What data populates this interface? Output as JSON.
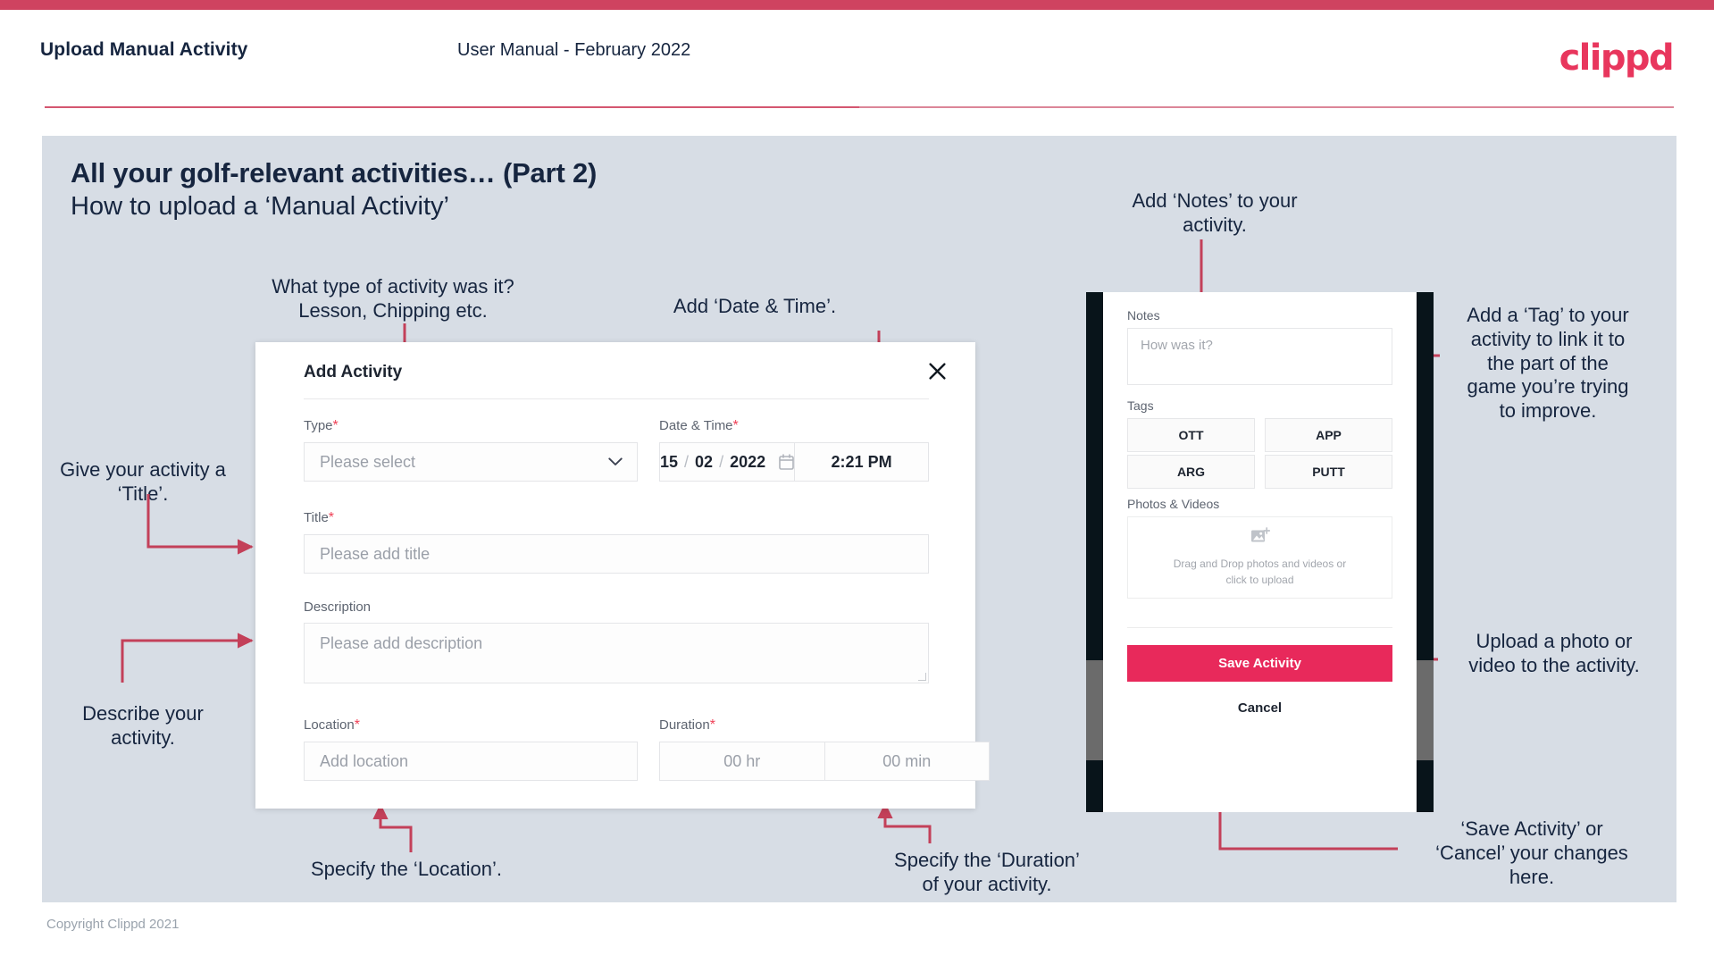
{
  "header": {
    "title": "Upload Manual Activity",
    "subtitle": "User Manual - February 2022",
    "brand": "clippd"
  },
  "slide": {
    "title": "All your golf-relevant activities… (Part 2)",
    "subtitle": "How to upload a ‘Manual Activity’",
    "footer": "Copyright Clippd 2021"
  },
  "dialog": {
    "title": "Add Activity",
    "close_icon": "close-icon",
    "fields": {
      "type": {
        "label": "Type",
        "required": "*",
        "placeholder": "Please select",
        "chevron": "⌄"
      },
      "datetime": {
        "label": "Date & Time",
        "required": "*",
        "day": "15",
        "month": "02",
        "year": "2022",
        "separator": "/",
        "time": "2:21 PM"
      },
      "title": {
        "label": "Title",
        "required": "*",
        "placeholder": "Please add title"
      },
      "description": {
        "label": "Description",
        "required": "",
        "placeholder": "Please add description"
      },
      "location": {
        "label": "Location",
        "required": "*",
        "placeholder": "Add location"
      },
      "duration": {
        "label": "Duration",
        "required": "*",
        "hours_placeholder": "00 hr",
        "minutes_placeholder": "00 min"
      }
    }
  },
  "phone": {
    "notes": {
      "label": "Notes",
      "placeholder": "How was it?"
    },
    "tags": {
      "label": "Tags",
      "items": [
        "OTT",
        "APP",
        "ARG",
        "PUTT"
      ]
    },
    "photos": {
      "label": "Photos & Videos",
      "dropzone_text": "Drag and Drop photos and videos or\nclick to upload"
    },
    "save_label": "Save Activity",
    "cancel_label": "Cancel"
  },
  "annotations": {
    "type": "What type of activity was it?\nLesson, Chipping etc.",
    "datetime": "Add ‘Date & Time’.",
    "title": "Give your activity a\n‘Title’.",
    "description": "Describe your\nactivity.",
    "location": "Specify the ‘Location’.",
    "duration": "Specify the ‘Duration’\nof your activity.",
    "notes": "Add ‘Notes’ to your\nactivity.",
    "tags": "Add a ‘Tag’ to your\nactivity to link it to\nthe part of the\ngame you’re trying\nto improve.",
    "upload": "Upload a photo or\nvideo to the activity.",
    "save": "‘Save Activity’ or\n‘Cancel’ your changes\nhere."
  },
  "colors": {
    "brand_pink": "#e8365d",
    "accent_crimson": "#cf4360",
    "slide_bg": "#d7dde5",
    "text_navy": "#16253f",
    "save_button": "#e8295b"
  }
}
